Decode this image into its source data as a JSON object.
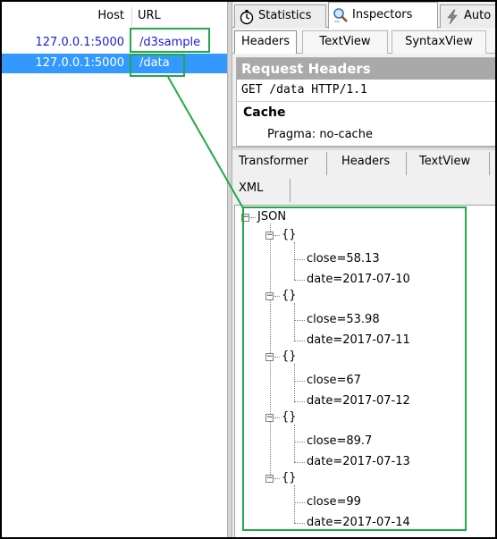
{
  "sessions": {
    "columns": {
      "host": "Host",
      "url": "URL"
    },
    "rows": [
      {
        "host": "127.0.0.1:5000",
        "url": "/d3sample"
      },
      {
        "host": "127.0.0.1:5000",
        "url": "/data"
      }
    ]
  },
  "inspector": {
    "main_tabs": [
      {
        "label": "Statistics",
        "icon": "stopwatch-icon"
      },
      {
        "label": "Inspectors",
        "icon": "magnifier-icon"
      },
      {
        "label": "Auto",
        "icon": "lightning-icon"
      }
    ],
    "request_tabs": [
      "Headers",
      "TextView",
      "SyntaxView"
    ],
    "request": {
      "title": "Request Headers",
      "line": "GET /data HTTP/1.1",
      "group": "Cache",
      "header": "Pragma: no-cache"
    },
    "response_tabs": [
      "Transformer",
      "Headers",
      "TextView",
      "XML"
    ],
    "tree": {
      "root": "JSON",
      "object_label": "{}",
      "items": [
        {
          "close": "close=58.13",
          "date": "date=2017-07-10"
        },
        {
          "close": "close=53.98",
          "date": "date=2017-07-11"
        },
        {
          "close": "close=67",
          "date": "date=2017-07-12"
        },
        {
          "close": "close=89.7",
          "date": "date=2017-07-13"
        },
        {
          "close": "close=99",
          "date": "date=2017-07-14"
        }
      ]
    }
  },
  "colors": {
    "highlight_green": "#23a847",
    "selection_blue": "#3399ff",
    "link_blue": "#1a1ad8",
    "header_gray": "#a9a9a9"
  }
}
